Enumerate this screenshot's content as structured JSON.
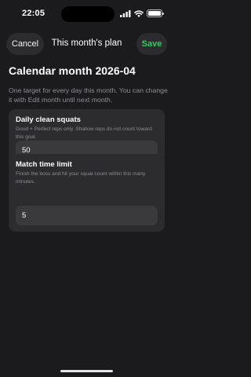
{
  "status_bar": {
    "time": "22:05",
    "icons": [
      "cellular-signal-icon",
      "wifi-icon",
      "battery-icon"
    ],
    "battery_level": 1.0
  },
  "nav": {
    "cancel_label": "Cancel",
    "title": "This month's plan",
    "save_label": "Save"
  },
  "header": {
    "title": "Calendar month 2026-04",
    "description": "One target for every day this month. You can change it with Edit month until next month."
  },
  "fields": [
    {
      "title": "Daily clean squats",
      "help": "Good + Perfect reps only. Shallow reps do not count toward this goal.",
      "value": "50"
    },
    {
      "title": "Match time limit",
      "help": "Finish the boss and hit your squat count within this many minutes.",
      "value": "5"
    }
  ],
  "colors": {
    "background": "#1b1b1d",
    "card": "#2c2c2e",
    "input": "#3a3a3c",
    "accent_save": "#36c864",
    "secondary_text": "#8e8e93"
  }
}
